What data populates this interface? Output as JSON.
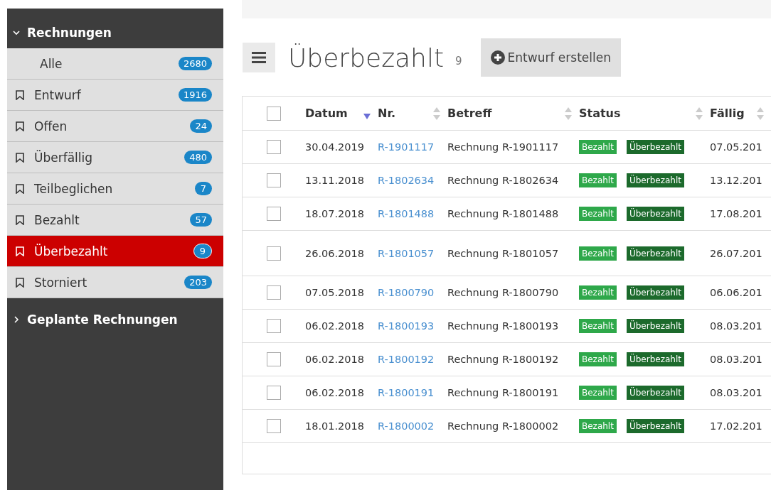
{
  "sidebar": {
    "groups": [
      {
        "label": "Rechnungen",
        "expanded": true,
        "items": [
          {
            "label": "Alle",
            "count": "2680",
            "bookmark": false,
            "selected": false
          },
          {
            "label": "Entwurf",
            "count": "1916",
            "bookmark": true,
            "selected": false
          },
          {
            "label": "Offen",
            "count": "24",
            "bookmark": true,
            "selected": false
          },
          {
            "label": "Überfällig",
            "count": "480",
            "bookmark": true,
            "selected": false
          },
          {
            "label": "Teilbeglichen",
            "count": "7",
            "bookmark": true,
            "selected": false
          },
          {
            "label": "Bezahlt",
            "count": "57",
            "bookmark": true,
            "selected": false
          },
          {
            "label": "Überbezahlt",
            "count": "9",
            "bookmark": true,
            "selected": true
          },
          {
            "label": "Storniert",
            "count": "203",
            "bookmark": true,
            "selected": false
          }
        ]
      },
      {
        "label": "Geplante Rechnungen",
        "expanded": false
      }
    ]
  },
  "header": {
    "title": "Überbezahlt",
    "count": "9",
    "button": "Entwurf erstellen"
  },
  "table": {
    "select_all_checked": false,
    "columns": [
      {
        "label": "Datum",
        "sorted": true
      },
      {
        "label": "Nr.",
        "sorted": false
      },
      {
        "label": "Betreff",
        "sorted": false
      },
      {
        "label": "Status",
        "sorted": false
      },
      {
        "label": "Fällig",
        "sorted": false
      }
    ],
    "rows": [
      {
        "checked": false,
        "date": "30.04.2019",
        "number": "R-1901117",
        "subject": "Rechnung R-1901117",
        "tags": [
          {
            "label": "Bezahlt",
            "color": "#2ea84a"
          },
          {
            "label": "Überbezahlt",
            "color": "#1c6a2c"
          }
        ],
        "due": "07.05.201"
      },
      {
        "checked": false,
        "date": "13.11.2018",
        "number": "R-1802634",
        "subject": "Rechnung R-1802634",
        "tags": [
          {
            "label": "Bezahlt",
            "color": "#2ea84a"
          },
          {
            "label": "Überbezahlt",
            "color": "#1c6a2c"
          }
        ],
        "due": "13.12.201"
      },
      {
        "checked": false,
        "date": "18.07.2018",
        "number": "R-1801488",
        "subject": "Rechnung R-1801488",
        "tags": [
          {
            "label": "Bezahlt",
            "color": "#2ea84a"
          },
          {
            "label": "Überbezahlt",
            "color": "#1c6a2c"
          }
        ],
        "due": "17.08.201"
      },
      {
        "checked": false,
        "date": "26.06.2018",
        "number": "R-1801057",
        "subject": "Rechnung R-1801057",
        "tags": [
          {
            "label": "Bezahlt",
            "color": "#2ea84a"
          },
          {
            "label": "Überbezahlt",
            "color": "#1c6a2c"
          }
        ],
        "due": "26.07.201"
      },
      {
        "checked": false,
        "date": "07.05.2018",
        "number": "R-1800790",
        "subject": "Rechnung R-1800790",
        "tags": [
          {
            "label": "Bezahlt",
            "color": "#2ea84a"
          },
          {
            "label": "Überbezahlt",
            "color": "#1c6a2c"
          }
        ],
        "due": "06.06.201"
      },
      {
        "checked": false,
        "date": "06.02.2018",
        "number": "R-1800193",
        "subject": "Rechnung R-1800193",
        "tags": [
          {
            "label": "Bezahlt",
            "color": "#2ea84a"
          },
          {
            "label": "Überbezahlt",
            "color": "#1c6a2c"
          }
        ],
        "due": "08.03.201"
      },
      {
        "checked": false,
        "date": "06.02.2018",
        "number": "R-1800192",
        "subject": "Rechnung R-1800192",
        "tags": [
          {
            "label": "Bezahlt",
            "color": "#2ea84a"
          },
          {
            "label": "Überbezahlt",
            "color": "#1c6a2c"
          }
        ],
        "due": "08.03.201"
      },
      {
        "checked": false,
        "date": "06.02.2018",
        "number": "R-1800191",
        "subject": "Rechnung R-1800191",
        "tags": [
          {
            "label": "Bezahlt",
            "color": "#2ea84a"
          },
          {
            "label": "Überbezahlt",
            "color": "#1c6a2c"
          }
        ],
        "due": "08.03.201"
      },
      {
        "checked": false,
        "date": "18.01.2018",
        "number": "R-1800002",
        "subject": "Rechnung R-1800002",
        "tags": [
          {
            "label": "Bezahlt",
            "color": "#2ea84a"
          },
          {
            "label": "Überbezahlt",
            "color": "#1c6a2c"
          }
        ],
        "due": "17.02.201"
      }
    ]
  }
}
